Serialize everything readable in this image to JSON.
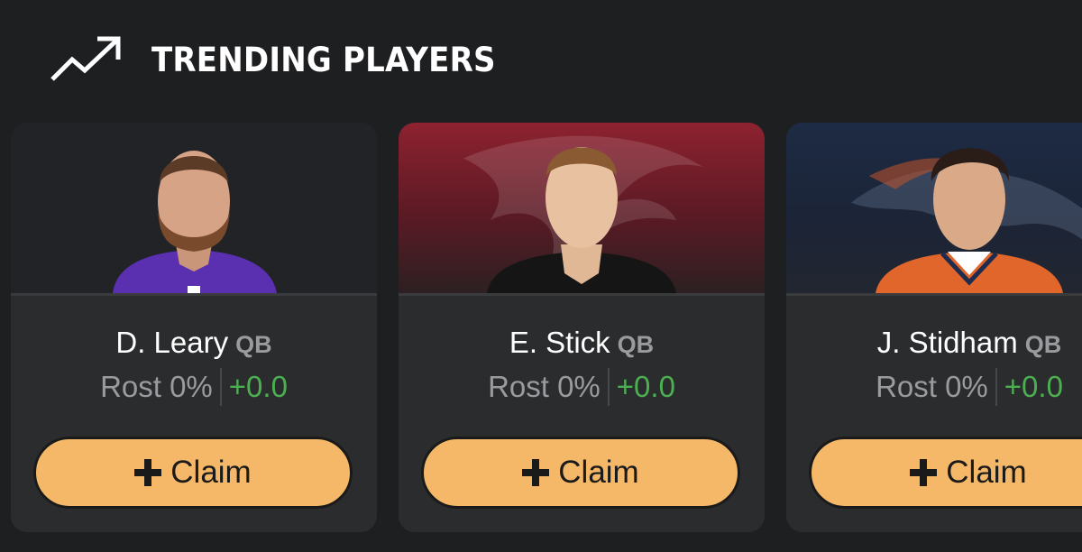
{
  "header": {
    "title": "TRENDING PLAYERS",
    "icon": "trending-up-icon"
  },
  "players": [
    {
      "name": "D. Leary",
      "position": "QB",
      "rost": "Rost 0%",
      "change": "+0.0",
      "button_label": "Claim",
      "button_icon": "plus-icon",
      "jersey_color": "#5a2fb0"
    },
    {
      "name": "E. Stick",
      "position": "QB",
      "rost": "Rost 0%",
      "change": "+0.0",
      "button_label": "Claim",
      "button_icon": "plus-icon",
      "jersey_color": "#151515"
    },
    {
      "name": "J. Stidham",
      "position": "QB",
      "rost": "Rost 0%",
      "change": "+0.0",
      "button_label": "Claim",
      "button_icon": "plus-icon",
      "jersey_color": "#e0662c"
    }
  ],
  "colors": {
    "background": "#1e1f21",
    "card": "#2b2c2e",
    "accent": "#f4b868",
    "positive": "#4caf50",
    "muted": "#9a9b9e"
  }
}
